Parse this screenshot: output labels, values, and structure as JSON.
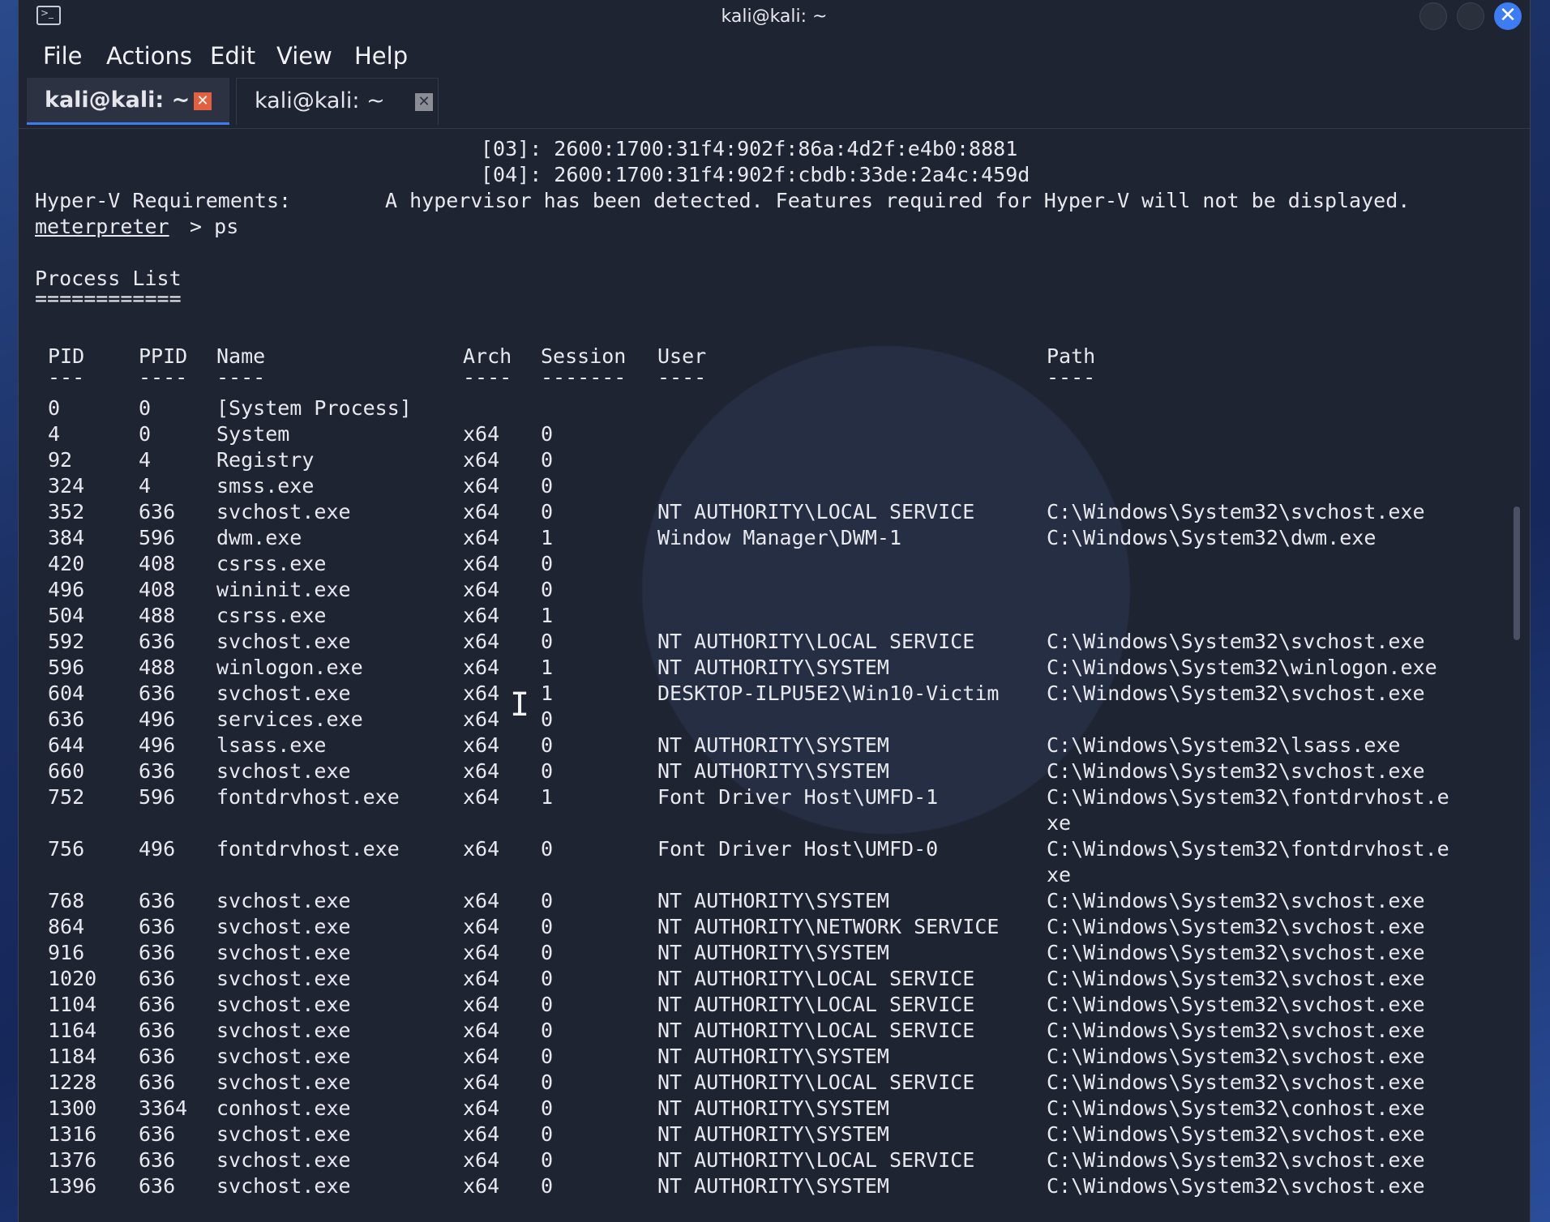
{
  "window": {
    "title": "kali@kali: ~",
    "close_glyph": "✕"
  },
  "menu": [
    "File",
    "Actions",
    "Edit",
    "View",
    "Help"
  ],
  "tabs": [
    {
      "label": "kali@kali: ~",
      "active": true,
      "close_glyph": "✕"
    },
    {
      "label": "kali@kali: ~",
      "active": false,
      "close_glyph": "✕"
    }
  ],
  "terminal": {
    "pre_lines": [
      "[03]: 2600:1700:31f4:902f:86a:4d2f:e4b0:8881",
      "[04]: 2600:1700:31f4:902f:cbdb:33de:2a4c:459d"
    ],
    "hyperv_label": "Hyper-V Requirements:",
    "hyperv_text": "A hypervisor has been detected. Features required for Hyper-V will not be displayed.",
    "prompt": "meterpreter",
    "prompt_suffix": " > ps",
    "section_title": "Process List",
    "section_underline": "============",
    "headers": [
      "PID",
      "PPID",
      "Name",
      "Arch",
      "Session",
      "User",
      "Path"
    ],
    "header_underlines": [
      "---",
      "----",
      "----",
      "----",
      "-------",
      "----",
      "----"
    ],
    "rows": [
      [
        "0",
        "0",
        "[System Process]",
        "",
        "",
        "",
        ""
      ],
      [
        "4",
        "0",
        "System",
        "x64",
        "0",
        "",
        ""
      ],
      [
        "92",
        "4",
        "Registry",
        "x64",
        "0",
        "",
        ""
      ],
      [
        "324",
        "4",
        "smss.exe",
        "x64",
        "0",
        "",
        ""
      ],
      [
        "352",
        "636",
        "svchost.exe",
        "x64",
        "0",
        "NT AUTHORITY\\LOCAL SERVICE",
        "C:\\Windows\\System32\\svchost.exe"
      ],
      [
        "384",
        "596",
        "dwm.exe",
        "x64",
        "1",
        "Window Manager\\DWM-1",
        "C:\\Windows\\System32\\dwm.exe"
      ],
      [
        "420",
        "408",
        "csrss.exe",
        "x64",
        "0",
        "",
        ""
      ],
      [
        "496",
        "408",
        "wininit.exe",
        "x64",
        "0",
        "",
        ""
      ],
      [
        "504",
        "488",
        "csrss.exe",
        "x64",
        "1",
        "",
        ""
      ],
      [
        "592",
        "636",
        "svchost.exe",
        "x64",
        "0",
        "NT AUTHORITY\\LOCAL SERVICE",
        "C:\\Windows\\System32\\svchost.exe"
      ],
      [
        "596",
        "488",
        "winlogon.exe",
        "x64",
        "1",
        "NT AUTHORITY\\SYSTEM",
        "C:\\Windows\\System32\\winlogon.exe"
      ],
      [
        "604",
        "636",
        "svchost.exe",
        "x64",
        "1",
        "DESKTOP-ILPU5E2\\Win10-Victim",
        "C:\\Windows\\System32\\svchost.exe"
      ],
      [
        "636",
        "496",
        "services.exe",
        "x64",
        "0",
        "",
        ""
      ],
      [
        "644",
        "496",
        "lsass.exe",
        "x64",
        "0",
        "NT AUTHORITY\\SYSTEM",
        "C:\\Windows\\System32\\lsass.exe"
      ],
      [
        "660",
        "636",
        "svchost.exe",
        "x64",
        "0",
        "NT AUTHORITY\\SYSTEM",
        "C:\\Windows\\System32\\svchost.exe"
      ],
      [
        "752",
        "596",
        "fontdrvhost.exe",
        "x64",
        "1",
        "Font Driver Host\\UMFD-1",
        "C:\\Windows\\System32\\fontdrvhost.e\nxe"
      ],
      [
        "756",
        "496",
        "fontdrvhost.exe",
        "x64",
        "0",
        "Font Driver Host\\UMFD-0",
        "C:\\Windows\\System32\\fontdrvhost.e\nxe"
      ],
      [
        "768",
        "636",
        "svchost.exe",
        "x64",
        "0",
        "NT AUTHORITY\\SYSTEM",
        "C:\\Windows\\System32\\svchost.exe"
      ],
      [
        "864",
        "636",
        "svchost.exe",
        "x64",
        "0",
        "NT AUTHORITY\\NETWORK SERVICE",
        "C:\\Windows\\System32\\svchost.exe"
      ],
      [
        "916",
        "636",
        "svchost.exe",
        "x64",
        "0",
        "NT AUTHORITY\\SYSTEM",
        "C:\\Windows\\System32\\svchost.exe"
      ],
      [
        "1020",
        "636",
        "svchost.exe",
        "x64",
        "0",
        "NT AUTHORITY\\LOCAL SERVICE",
        "C:\\Windows\\System32\\svchost.exe"
      ],
      [
        "1104",
        "636",
        "svchost.exe",
        "x64",
        "0",
        "NT AUTHORITY\\LOCAL SERVICE",
        "C:\\Windows\\System32\\svchost.exe"
      ],
      [
        "1164",
        "636",
        "svchost.exe",
        "x64",
        "0",
        "NT AUTHORITY\\LOCAL SERVICE",
        "C:\\Windows\\System32\\svchost.exe"
      ],
      [
        "1184",
        "636",
        "svchost.exe",
        "x64",
        "0",
        "NT AUTHORITY\\SYSTEM",
        "C:\\Windows\\System32\\svchost.exe"
      ],
      [
        "1228",
        "636",
        "svchost.exe",
        "x64",
        "0",
        "NT AUTHORITY\\LOCAL SERVICE",
        "C:\\Windows\\System32\\svchost.exe"
      ],
      [
        "1300",
        "3364",
        "conhost.exe",
        "x64",
        "0",
        "NT AUTHORITY\\SYSTEM",
        "C:\\Windows\\System32\\conhost.exe"
      ],
      [
        "1316",
        "636",
        "svchost.exe",
        "x64",
        "0",
        "NT AUTHORITY\\SYSTEM",
        "C:\\Windows\\System32\\svchost.exe"
      ],
      [
        "1376",
        "636",
        "svchost.exe",
        "x64",
        "0",
        "NT AUTHORITY\\LOCAL SERVICE",
        "C:\\Windows\\System32\\svchost.exe"
      ],
      [
        "1396",
        "636",
        "svchost.exe",
        "x64",
        "0",
        "NT AUTHORITY\\SYSTEM",
        "C:\\Windows\\System32\\svchost.exe"
      ]
    ]
  }
}
